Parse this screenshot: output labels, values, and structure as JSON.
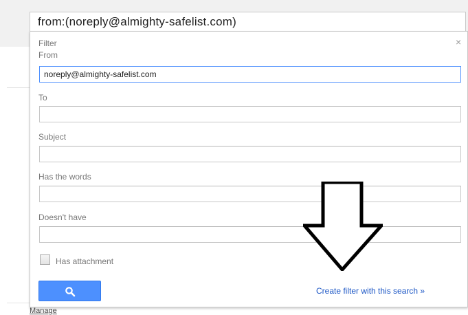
{
  "search": {
    "query": "from:(noreply@almighty-safelist.com)"
  },
  "filter_panel": {
    "title": "Filter",
    "close_glyph": "×",
    "fields": {
      "from": {
        "label": "From",
        "value": "noreply@almighty-safelist.com"
      },
      "to": {
        "label": "To",
        "value": ""
      },
      "subject": {
        "label": "Subject",
        "value": ""
      },
      "has_words": {
        "label": "Has the words",
        "value": ""
      },
      "doesnt_have": {
        "label": "Doesn't have",
        "value": ""
      }
    },
    "has_attachment": {
      "label": "Has attachment",
      "checked": false
    },
    "search_button": {
      "icon": "search-icon",
      "color": "#4d90fe"
    },
    "create_filter_link": "Create filter with this search »"
  },
  "footer": {
    "manage_link": "Manage"
  },
  "annotation": {
    "icon": "down-arrow-icon",
    "color": "#000000"
  }
}
